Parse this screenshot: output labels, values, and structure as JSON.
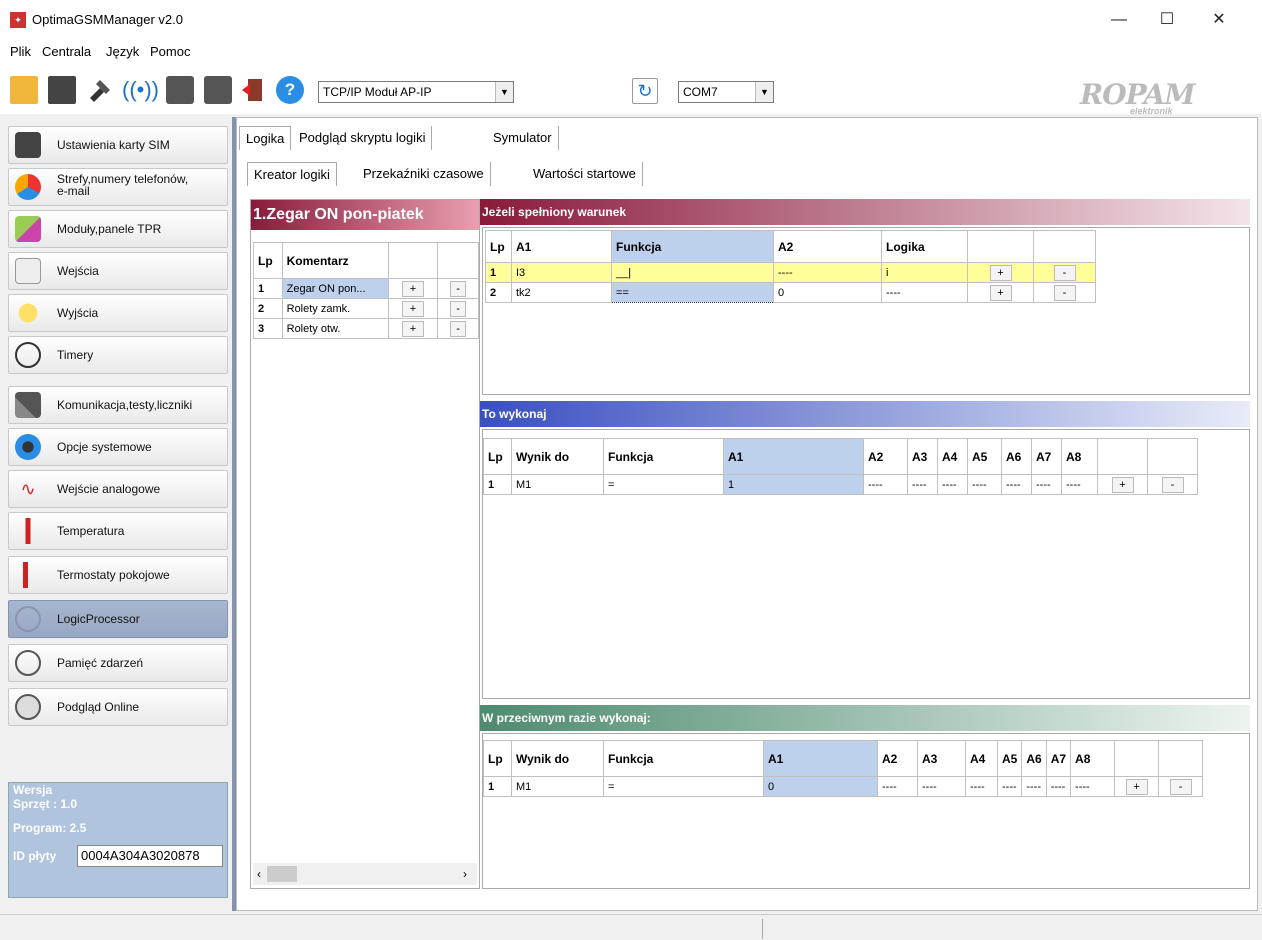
{
  "window": {
    "title": "OptimaGSMManager v2.0",
    "minimize": "—",
    "maximize": "☐",
    "close": "✕"
  },
  "menu": [
    "Plik",
    "Centrala",
    "Język",
    "Pomoc"
  ],
  "toolbar": {
    "connection": "TCP/IP Moduł AP-IP",
    "port": "COM7",
    "logo": "ROPAM",
    "logo_sub": "elektronik"
  },
  "sidebar": {
    "items": [
      {
        "label": "Ustawienia karty SIM",
        "icon": "sim-card-icon"
      },
      {
        "label": "Strefy,numery telefonów,",
        "label2": "e-mail",
        "icon": "zones-icon"
      },
      {
        "label": "Moduły,panele TPR",
        "icon": "modules-icon"
      },
      {
        "label": "Wejścia",
        "icon": "input-icon"
      },
      {
        "label": "Wyjścia",
        "icon": "output-icon"
      },
      {
        "label": "Timery",
        "icon": "timer-icon"
      },
      {
        "label": "Komunikacja,testy,liczniki",
        "icon": "tools-icon"
      },
      {
        "label": "Opcje systemowe",
        "icon": "gear-icon"
      },
      {
        "label": "Wejście analogowe",
        "icon": "analog-icon"
      },
      {
        "label": "Temperatura",
        "icon": "thermometer-icon"
      },
      {
        "label": "Termostaty pokojowe",
        "icon": "thermostat-icon"
      },
      {
        "label": "LogicProcessor",
        "icon": "logic-icon"
      },
      {
        "label": "Pamięć zdarzeń",
        "icon": "event-memory-icon"
      },
      {
        "label": "Podgląd Online",
        "icon": "online-view-icon"
      }
    ],
    "version": {
      "title": "Wersja",
      "hw": "Sprzęt : 1.0",
      "prog": "Program: 2.5",
      "id_label": "ID płyty",
      "id_value": "0004A304A3020878"
    }
  },
  "tabs_top": [
    "Logika",
    "Podgląd skryptu logiki",
    "Symulator"
  ],
  "tabs_sub": [
    "Kreator logiki",
    "Przekaźniki czasowe",
    "Wartości startowe"
  ],
  "rules": {
    "title": "1.Zegar ON pon-piatek",
    "headers": [
      "Lp",
      "Komentarz"
    ],
    "rows": [
      {
        "lp": "1",
        "comment": "Zegar ON pon..."
      },
      {
        "lp": "2",
        "comment": "Rolety zamk."
      },
      {
        "lp": "3",
        "comment": "Rolety otw."
      }
    ],
    "plus": "+",
    "minus": "-"
  },
  "condition": {
    "title": "Jeżeli spełniony warunek",
    "headers": [
      "Lp",
      "A1",
      "Funkcja",
      "A2",
      "Logika"
    ],
    "rows": [
      {
        "lp": "1",
        "a1": "I3",
        "func": "__|",
        "a2": "----",
        "logic": "i"
      },
      {
        "lp": "2",
        "a1": "tk2",
        "func": "==",
        "a2": "0",
        "logic": "----"
      }
    ]
  },
  "then": {
    "title": "To wykonaj",
    "headers": [
      "Lp",
      "Wynik do",
      "Funkcja",
      "A1",
      "A2",
      "A3",
      "A4",
      "A5",
      "A6",
      "A7",
      "A8"
    ],
    "rows": [
      {
        "lp": "1",
        "out": "M1",
        "func": "=",
        "a1": "1",
        "rest": "----"
      }
    ]
  },
  "else": {
    "title": "W przeciwnym razie wykonaj:",
    "headers": [
      "Lp",
      "Wynik do",
      "Funkcja",
      "A1",
      "A2",
      "A3",
      "A4",
      "A5",
      "A6",
      "A7",
      "A8"
    ],
    "rows": [
      {
        "lp": "1",
        "out": "M1",
        "func": "=",
        "a1": "0",
        "rest": "----"
      }
    ]
  }
}
